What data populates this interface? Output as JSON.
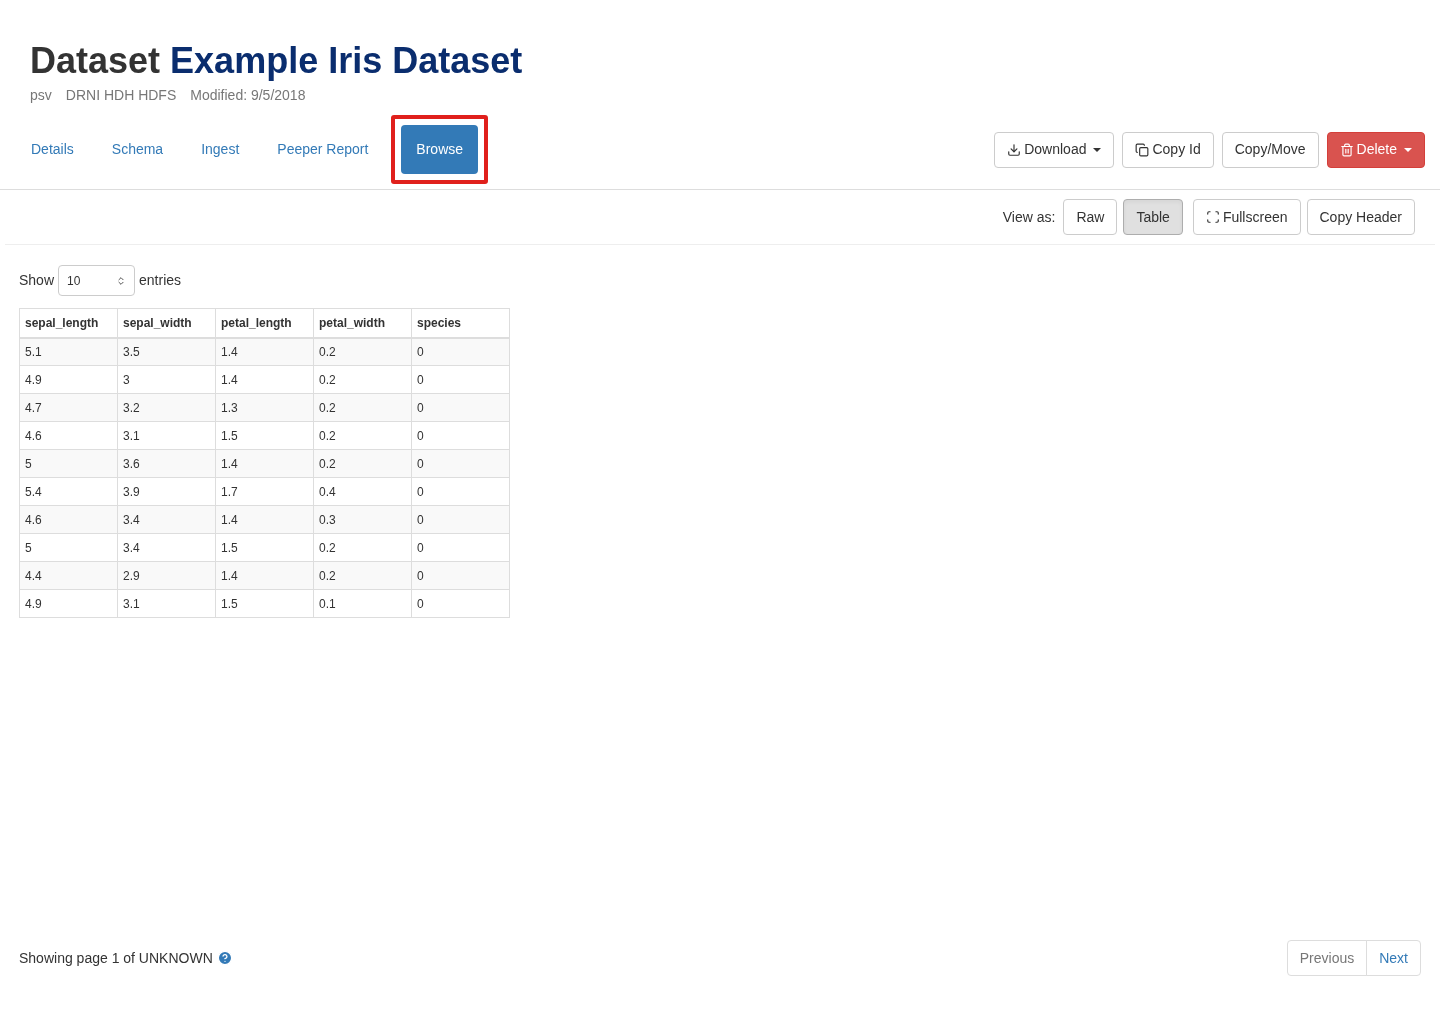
{
  "header": {
    "title_prefix": "Dataset",
    "title_name": "Example Iris Dataset",
    "meta": [
      "psv",
      "DRNI HDH HDFS",
      "Modified: 9/5/2018"
    ]
  },
  "tabs": [
    {
      "label": "Details",
      "selected": false,
      "highlighted": false
    },
    {
      "label": "Schema",
      "selected": false,
      "highlighted": false
    },
    {
      "label": "Ingest",
      "selected": false,
      "highlighted": false
    },
    {
      "label": "Peeper Report",
      "selected": false,
      "highlighted": false
    },
    {
      "label": "Browse",
      "selected": true,
      "highlighted": true
    }
  ],
  "actions": [
    {
      "kind": "download",
      "label": "Download",
      "dropdown": true
    },
    {
      "kind": "copy",
      "label": "Copy Id",
      "dropdown": false
    },
    {
      "kind": "plain",
      "label": "Copy/Move",
      "dropdown": false
    },
    {
      "kind": "delete",
      "label": "Delete",
      "dropdown": true
    }
  ],
  "view": {
    "label": "View as:",
    "modes": [
      {
        "label": "Raw",
        "selected": false
      },
      {
        "label": "Table",
        "selected": true
      }
    ],
    "fullscreen": "Fullscreen",
    "copy_header": "Copy Header"
  },
  "length": {
    "before": "Show",
    "value": "10",
    "after": "entries"
  },
  "table": {
    "columns": [
      "sepal_length",
      "sepal_width",
      "petal_length",
      "petal_width",
      "species"
    ],
    "rows": [
      [
        "5.1",
        "3.5",
        "1.4",
        "0.2",
        "0"
      ],
      [
        "4.9",
        "3",
        "1.4",
        "0.2",
        "0"
      ],
      [
        "4.7",
        "3.2",
        "1.3",
        "0.2",
        "0"
      ],
      [
        "4.6",
        "3.1",
        "1.5",
        "0.2",
        "0"
      ],
      [
        "5",
        "3.6",
        "1.4",
        "0.2",
        "0"
      ],
      [
        "5.4",
        "3.9",
        "1.7",
        "0.4",
        "0"
      ],
      [
        "4.6",
        "3.4",
        "1.4",
        "0.3",
        "0"
      ],
      [
        "5",
        "3.4",
        "1.5",
        "0.2",
        "0"
      ],
      [
        "4.4",
        "2.9",
        "1.4",
        "0.2",
        "0"
      ],
      [
        "4.9",
        "3.1",
        "1.5",
        "0.1",
        "0"
      ]
    ]
  },
  "footer": {
    "status": "Showing page 1 of UNKNOWN",
    "pager": [
      {
        "label": "Previous",
        "disabled": true
      },
      {
        "label": "Next",
        "disabled": false
      }
    ]
  }
}
